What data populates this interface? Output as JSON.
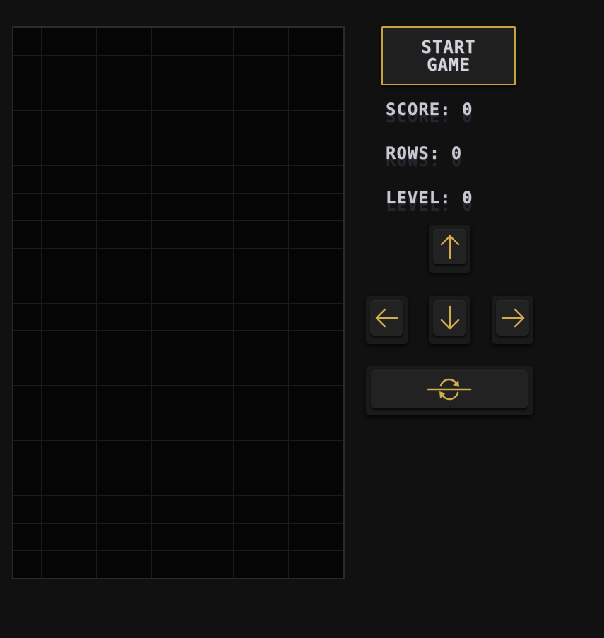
{
  "board": {
    "columns": 12,
    "rows": 20,
    "background_color": "#050505",
    "grid_color": "#1b1b1b",
    "border_color": "#2a2a2a"
  },
  "controls": {
    "start_label": "START GAME",
    "accent_color": "#d2ab4c"
  },
  "stats": {
    "score": "SCORE: 0",
    "rows": "ROWS: 0",
    "level": "LEVEL: 0"
  },
  "keys": {
    "up": "arrow-up-icon",
    "left": "arrow-left-icon",
    "down": "arrow-down-icon",
    "right": "arrow-right-icon",
    "rotate": "rotate-icon"
  }
}
